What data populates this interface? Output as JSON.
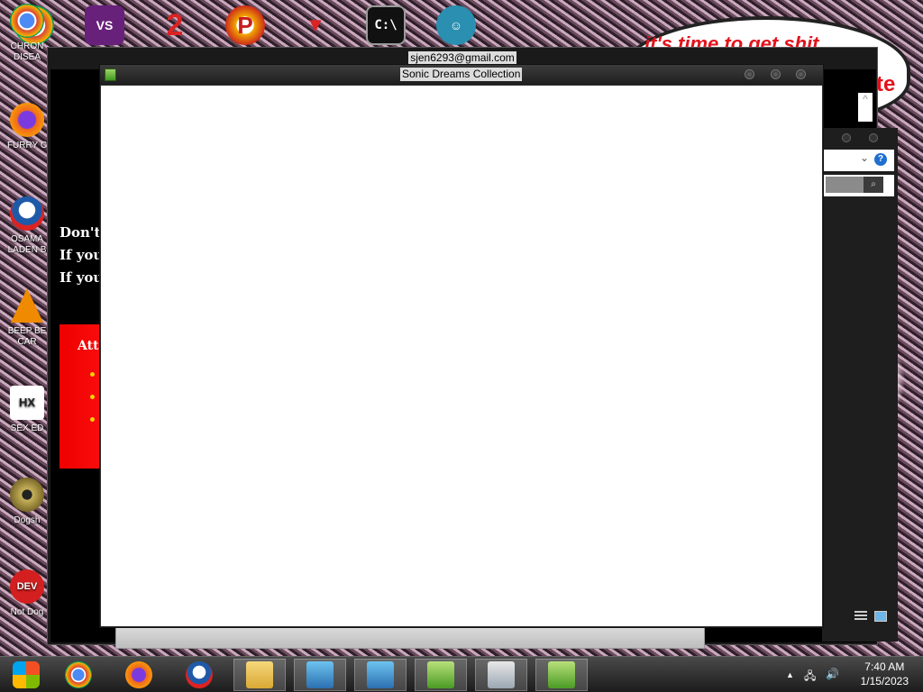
{
  "desktop": {
    "icons": [
      {
        "label_1": "CHRON",
        "label_2": "DISEA",
        "icon": "chrome-icon",
        "color": "#2c8f3e"
      },
      {
        "label_1": "FURRY C",
        "label_2": "",
        "icon": "firefox-icon",
        "color": "#f06a1c"
      },
      {
        "label_1": "OSAMA",
        "label_2": "LADEN B",
        "icon": "obama-logo-icon",
        "color": "#1f5aa8"
      },
      {
        "label_1": "BEEP BE",
        "label_2": "CAR",
        "icon": "vlc-cone-icon",
        "color": "#f08a00"
      },
      {
        "label_1": "SEX ED",
        "label_2": "",
        "icon": "hx-icon",
        "color": "#3a3a3a"
      },
      {
        "label_1": "Dogsh",
        "label_2": "",
        "icon": "disc-icon",
        "color": "#b8a04a"
      },
      {
        "label_1": "Not Dog",
        "label_2": "",
        "icon": "devcpp-icon",
        "color": "#d31f1f"
      }
    ],
    "bubble_text": "it's time to get shit",
    "bubble_tail": "te"
  },
  "background_window": {
    "title": "sjen6293@gmail.com",
    "lines": [
      "Don't",
      "If you",
      "If you"
    ],
    "panel_title": "Att",
    "scroll_up": "^"
  },
  "main_window": {
    "title": "Sonic Dreams Collection"
  },
  "mid_window": {
    "dropdown_arrow": "⌄",
    "help": "?",
    "search_glyph": "⌕"
  },
  "taskbar": {
    "clock_time": "7:40 AM",
    "clock_date": "1/15/2023",
    "tray_up": "▲",
    "volume": "🔊",
    "network": "🖧"
  }
}
